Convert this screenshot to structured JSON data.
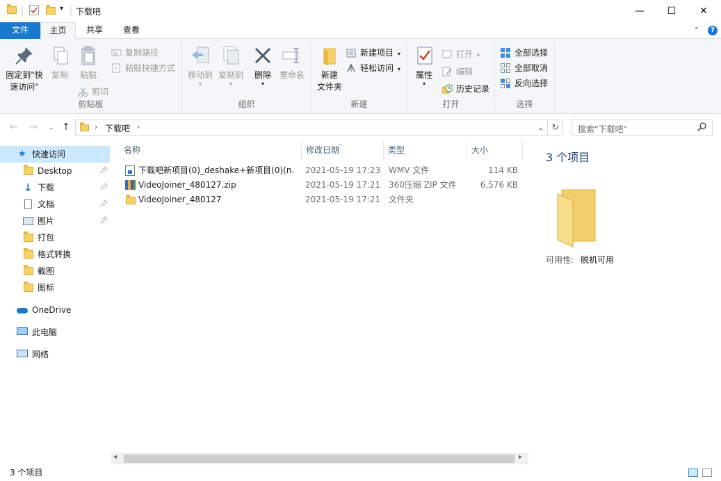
{
  "window": {
    "title": "下载吧",
    "minimize_glyph": "—",
    "maximize_glyph": "☐",
    "close_glyph": "✕"
  },
  "ribbon_tabs": {
    "file": "文件",
    "home": "主页",
    "share": "共享",
    "view": "查看"
  },
  "ribbon": {
    "clipboard": {
      "pin_label_1": "固定到\"快",
      "pin_label_2": "速访问\"",
      "copy": "复制",
      "paste": "粘贴",
      "copy_path": "复制路径",
      "paste_shortcut": "粘贴快捷方式",
      "cut": "剪切",
      "group_label": "剪贴板"
    },
    "organize": {
      "move_to": "移动到",
      "copy_to": "复制到",
      "delete": "删除",
      "rename": "重命名",
      "group_label": "组织"
    },
    "new": {
      "new_folder_1": "新建",
      "new_folder_2": "文件夹",
      "new_item": "新建项目",
      "easy_access": "轻松访问",
      "group_label": "新建"
    },
    "open": {
      "properties": "属性",
      "open": "打开",
      "edit": "编辑",
      "history": "历史记录",
      "group_label": "打开"
    },
    "select": {
      "select_all": "全部选择",
      "select_none": "全部取消",
      "invert": "反向选择",
      "group_label": "选择"
    }
  },
  "address": {
    "path": "下载吧",
    "search_placeholder": "搜索\"下载吧\""
  },
  "nav_pane": {
    "quick_access": "快速访问",
    "items": [
      {
        "label": "Desktop",
        "pinned": true
      },
      {
        "label": "下载",
        "pinned": true
      },
      {
        "label": "文档",
        "pinned": true
      },
      {
        "label": "图片",
        "pinned": true
      },
      {
        "label": "打包",
        "pinned": false
      },
      {
        "label": "格式转换",
        "pinned": false
      },
      {
        "label": "截图",
        "pinned": false
      },
      {
        "label": "图标",
        "pinned": false
      }
    ],
    "onedrive": "OneDrive",
    "this_pc": "此电脑",
    "network": "网络"
  },
  "file_list": {
    "columns": {
      "name": "名称",
      "date": "修改日期",
      "type": "类型",
      "size": "大小"
    },
    "rows": [
      {
        "name": "下载吧新项目(0)_deshake+新项目(0)(n...",
        "date": "2021-05-19 17:23",
        "type": "WMV 文件",
        "size": "114 KB",
        "icon": "video-file-icon"
      },
      {
        "name": "VideoJoiner_480127.zip",
        "date": "2021-05-19 17:21",
        "type": "360压缩 ZIP 文件",
        "size": "6,576 KB",
        "icon": "zip-archive-icon"
      },
      {
        "name": "VideoJoiner_480127",
        "date": "2021-05-19 17:21",
        "type": "文件夹",
        "size": "",
        "icon": "folder-icon"
      }
    ]
  },
  "details_pane": {
    "title": "3 个项目",
    "availability_label": "可用性:",
    "availability_value": "脱机可用"
  },
  "status": {
    "count": "3 个项目"
  },
  "colors": {
    "accent": "#1979ca",
    "folder": "#f6d26a",
    "selection": "#cce8ff"
  }
}
